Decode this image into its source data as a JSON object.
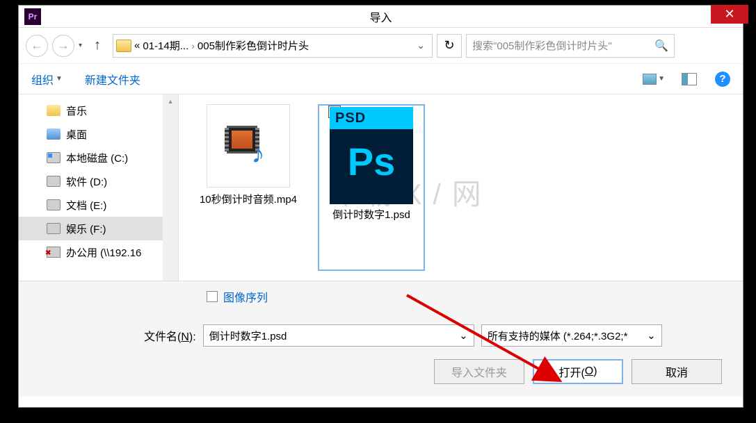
{
  "app_icon_text": "Pr",
  "title": "导入",
  "breadcrumb": {
    "parent": "01-14期...",
    "current": "005制作彩色倒计时片头",
    "prefix": "«"
  },
  "search_placeholder": "搜索\"005制作彩色倒计时片头\"",
  "toolbar": {
    "organize": "组织",
    "newfolder": "新建文件夹"
  },
  "sidebar": {
    "items": [
      {
        "label": "音乐",
        "icon": "ico-music"
      },
      {
        "label": "桌面",
        "icon": "ico-desktop"
      },
      {
        "label": "本地磁盘 (C:)",
        "icon": "ico-disk c"
      },
      {
        "label": "软件 (D:)",
        "icon": "ico-disk"
      },
      {
        "label": "文档 (E:)",
        "icon": "ico-disk"
      },
      {
        "label": "娱乐 (F:)",
        "icon": "ico-disk",
        "selected": true
      },
      {
        "label": "办公用 (\\\\192.16",
        "icon": "ico-net"
      }
    ]
  },
  "files": {
    "video": "10秒倒计时音频.mp4",
    "psd": "倒计时数字1.psd",
    "psd_badge": "PSD",
    "psd_text": "Ps",
    "check": "✓"
  },
  "watermark": "下载 X / 网",
  "checkbox_label": "图像序列",
  "filename_label_pre": "文件名(",
  "filename_label_u": "N",
  "filename_label_post": "):",
  "filename_value": "倒计时数字1.psd",
  "filter_value": "所有支持的媒体 (*.264;*.3G2;*",
  "buttons": {
    "import_folder": "导入文件夹",
    "open_pre": "打开(",
    "open_u": "O",
    "open_post": ")",
    "cancel": "取消"
  }
}
